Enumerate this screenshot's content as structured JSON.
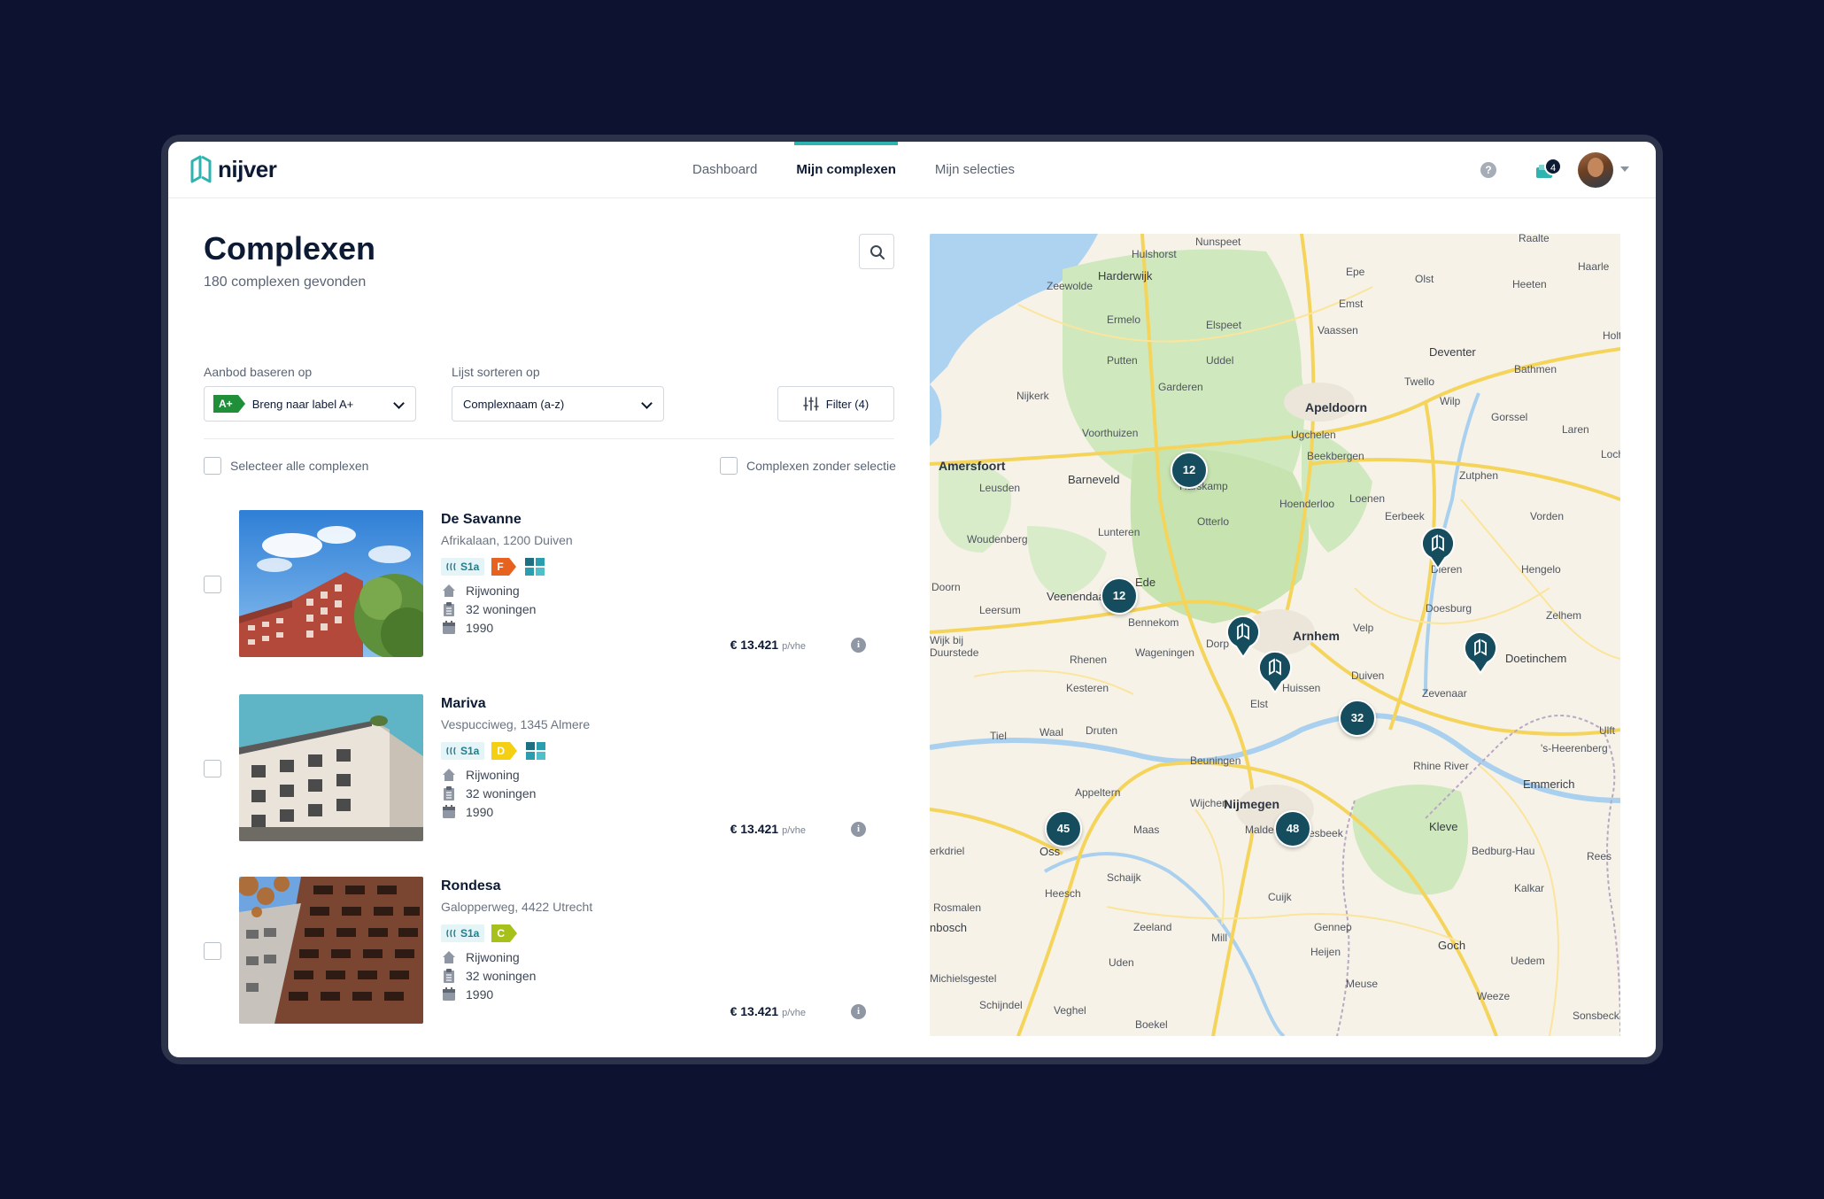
{
  "app": {
    "logo_text": "nijver"
  },
  "nav": {
    "items": [
      {
        "label": "Dashboard",
        "active": false
      },
      {
        "label": "Mijn complexen",
        "active": true
      },
      {
        "label": "Mijn selecties",
        "active": false
      }
    ]
  },
  "header": {
    "help": "?",
    "notification_count": "4"
  },
  "page": {
    "title": "Complexen",
    "subtitle": "180 complexen gevonden"
  },
  "controls": {
    "aanbod_label": "Aanbod baseren op",
    "aanbod_tag": "A+",
    "aanbod_value": "Breng naar label A+",
    "sort_label": "Lijst sorteren op",
    "sort_value": "Complexnaam (a-z)",
    "filter_label": "Filter (4)",
    "select_all": "Selecteer alle complexen",
    "without_selection": "Complexen zonder selectie"
  },
  "complexes": [
    {
      "name": "De Savanne",
      "address": "Afrikalaan, 1200 Duiven",
      "heating": "S1a",
      "energy_label": "F",
      "energy_color": "#e8621f",
      "has_grid_icon": true,
      "type": "Rijwoning",
      "units": "32 woningen",
      "year": "1990",
      "price": "€ 13.421",
      "price_unit": "p/vhe"
    },
    {
      "name": "Mariva",
      "address": "Vespucciweg, 1345 Almere",
      "heating": "S1a",
      "energy_label": "D",
      "energy_color": "#f4cf12",
      "has_grid_icon": true,
      "type": "Rijwoning",
      "units": "32 woningen",
      "year": "1990",
      "price": "€ 13.421",
      "price_unit": "p/vhe"
    },
    {
      "name": "Rondesa",
      "address": "Galopperweg, 4422 Utrecht",
      "heating": "S1a",
      "energy_label": "C",
      "energy_color": "#a8c11a",
      "has_grid_icon": false,
      "type": "Rijwoning",
      "units": "32 woningen",
      "year": "1990",
      "price": "€ 13.421",
      "price_unit": "p/vhe"
    }
  ],
  "map": {
    "clusters": [
      "12",
      "12",
      "32",
      "45",
      "48"
    ],
    "places": [
      "Nunspeet",
      "Hulshorst",
      "Harderwijk",
      "Zeewolde",
      "Epe",
      "Raalte",
      "Heeten",
      "Hoenderloo",
      "Olst",
      "Haarle",
      "Emst",
      "Ermelo",
      "Elspeet",
      "Vaassen",
      "Deventer",
      "Holt",
      "Putten",
      "Uddel",
      "Twello",
      "Bathmen",
      "Nijkerk",
      "Garderen",
      "Wilp",
      "Apeldoorn",
      "Gorssel",
      "Voorthuizen",
      "Ugchelen",
      "Laren",
      "Amersfoort",
      "Beekbergen",
      "Barneveld",
      "Loch",
      "Zutphen",
      "Leusden",
      "Loenen",
      "Otterlo",
      "Eerbeek",
      "Vorden",
      "Lunteren",
      "Woudenberg",
      "Dieren",
      "Hengelo",
      "Ede",
      "Doorn",
      "Veenendaal",
      "Doesburg",
      "Leersum",
      "Bennekom",
      "Zelhem",
      "Arnhem",
      "Velp",
      "Wijk bij",
      "Duurstede",
      "Rhenen",
      "Wageningen",
      "Doetinchem",
      "Duiven",
      "Zevenaar",
      "Kesteren",
      "Huissen",
      "Elst",
      "Tiel",
      "Waal",
      "Druten",
      "Ulft",
      "'s-Heerenberg",
      "Beuningen",
      "Rhine River",
      "Emmerich",
      "Appeltern",
      "Wijchen",
      "Nijmegen",
      "Oss",
      "Malden",
      "Groesbeek",
      "Kleve",
      "erkdriel",
      "Maas",
      "Schaijk",
      "Bedburg-Hau",
      "Rees",
      "Heesch",
      "Cuijk",
      "Kalkar",
      "Rosmalen",
      "nbosch",
      "Zeeland",
      "Gennep",
      "Mill",
      "Goch",
      "Uden",
      "Heijen",
      "Uedem",
      "Michielsgestel",
      "Meuse",
      "Weeze",
      "Schijndel",
      "Veghel",
      "Boekel",
      "Sonsbeck",
      "Dorp",
      "Harskamp"
    ]
  },
  "colors": {
    "accent": "#2fb3b0",
    "navy": "#0d1a33",
    "map_marker": "#164d5e",
    "background": "#0c1230",
    "aanbod_tag": "#1f8f3a"
  }
}
